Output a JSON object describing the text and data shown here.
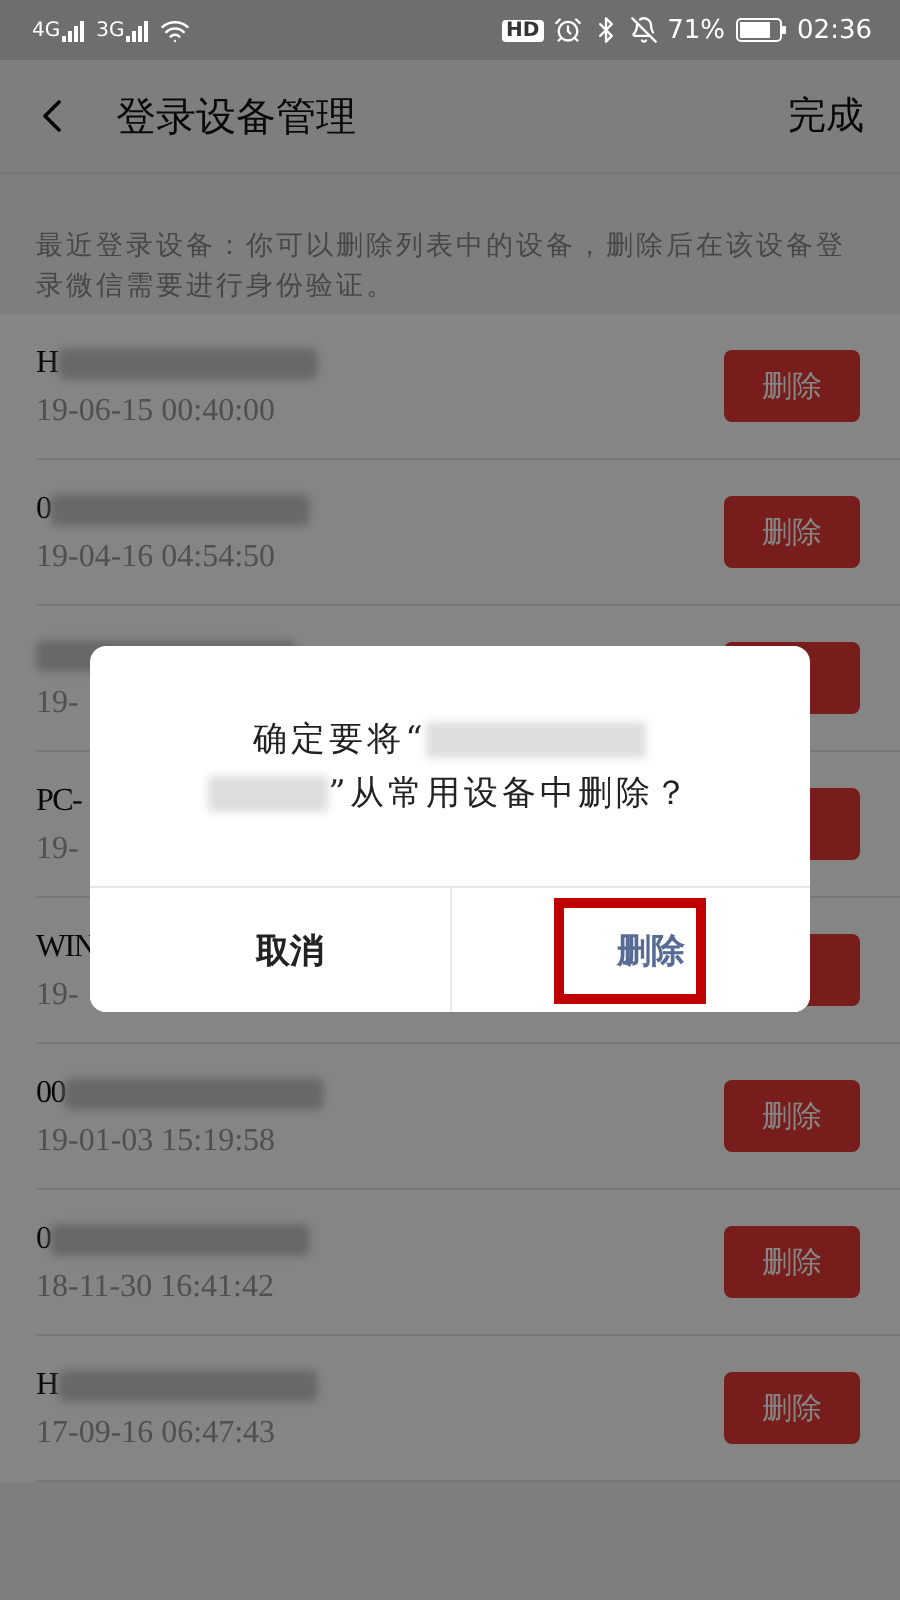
{
  "status_bar": {
    "left": [
      "4G",
      "3G"
    ],
    "hd": "HD",
    "battery": "71%",
    "time": "02:36"
  },
  "header": {
    "title": "登录设备管理",
    "action": "完成"
  },
  "hint": "最近登录设备：你可以删除列表中的设备，删除后在该设备登录微信需要进行身份验证。",
  "devices": [
    {
      "name": "H",
      "redacted": true,
      "time": "19-06-15 00:40:00",
      "button": "删除"
    },
    {
      "name": "0",
      "redacted": true,
      "time": "19-04-16 04:54:50",
      "button": "删除"
    },
    {
      "redacted": true,
      "time": "19-"
    },
    {
      "name": "PC-",
      "time": "19-"
    },
    {
      "name": "WIN",
      "time": "19-"
    },
    {
      "name": "00",
      "redacted": true,
      "time": "19-01-03 15:19:58",
      "button": "删除"
    },
    {
      "name": "0",
      "redacted": true,
      "time": "18-11-30 16:41:42",
      "button": "删除"
    },
    {
      "name": "H",
      "redacted": true,
      "time": "17-09-16 06:47:43",
      "button": "删除"
    }
  ],
  "dialog": {
    "message_start": "确定要将“",
    "message_end": "”从常用设备中删除？",
    "buttons": [
      {
        "label": "取消",
        "kind": "cancel",
        "highlighted": false
      },
      {
        "label": "删除",
        "kind": "confirm",
        "highlighted": true
      }
    ]
  }
}
